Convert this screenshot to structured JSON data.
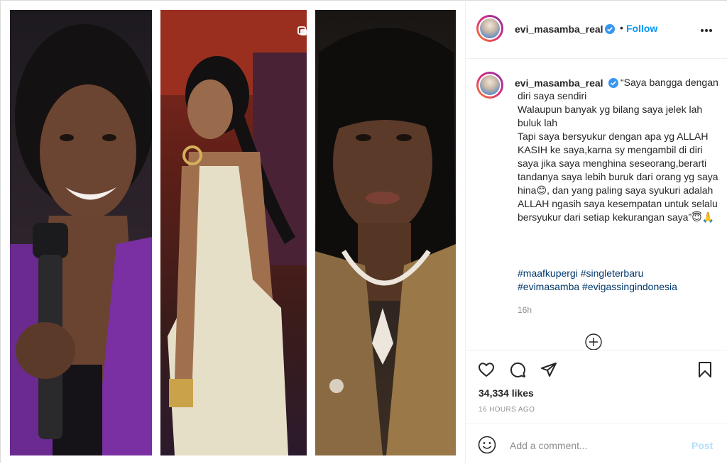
{
  "header": {
    "username": "evi_masamba_real",
    "separator": "•",
    "follow_label": "Follow"
  },
  "caption": {
    "username": "evi_masamba_real",
    "lines": [
      "“Saya bangga dengan diri saya sendiri",
      "Walaupun banyak yg bilang saya jelek lah buluk lah",
      "Tapi saya bersyukur dengan apa yg ALLAH KASIH ke saya,karna sy mengambil di diri saya jika saya menghina seseorang,berarti tandanya saya lebih buruk dari orang yg saya hina😊, dan yang paling saya syukuri adalah ALLAH ngasih saya kesempatan untuk selalu bersyukur dari setiap kekurangan saya”😇🙏"
    ],
    "hashtags_line1": "#maafkupergi #singleterbaru",
    "hashtags_line2": "#evimasamba #evigassingindonesia",
    "relative_time": "16h"
  },
  "actions": {
    "likes": "34,334 likes",
    "post_time": "16 HOURS AGO"
  },
  "comment": {
    "placeholder": "Add a comment...",
    "post_label": "Post"
  },
  "icons": {
    "verified": "verified-badge-icon",
    "more": "more-options-icon",
    "heart": "heart-icon",
    "comment": "comment-icon",
    "share": "share-icon",
    "save": "bookmark-icon",
    "emoji": "emoji-icon",
    "load_more": "plus-circle-icon",
    "multi": "multiple-images-icon"
  },
  "colors": {
    "accent": "#0095f6",
    "link": "#00376b",
    "muted": "#8e8e8e",
    "post_disabled": "#b2dffc"
  }
}
